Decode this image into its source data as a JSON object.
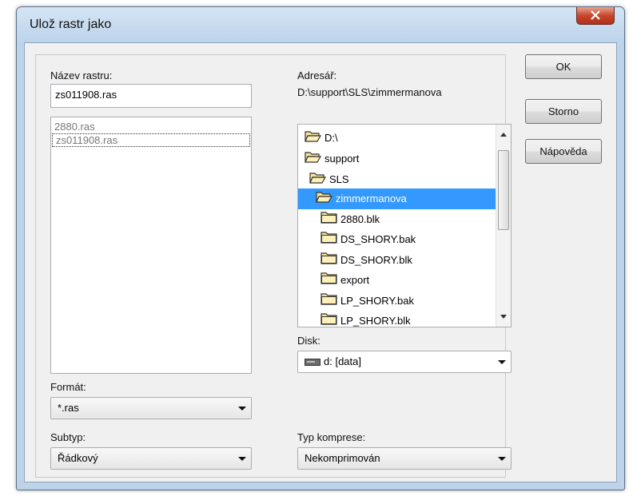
{
  "window": {
    "title": "Ulož rastr jako"
  },
  "name_section": {
    "label": "Název rastru:",
    "value": "zs011908.ras",
    "files": [
      "2880.ras",
      "zs011908.ras"
    ]
  },
  "dir_section": {
    "label": "Adresář:",
    "path": "D:\\support\\SLS\\zimmermanova",
    "tree": [
      {
        "label": "D:\\",
        "state": "open"
      },
      {
        "label": "support",
        "state": "open"
      },
      {
        "label": "SLS",
        "state": "open"
      },
      {
        "label": "zimmermanova",
        "state": "open",
        "selected": true
      },
      {
        "label": "2880.blk",
        "state": "closed"
      },
      {
        "label": "DS_SHORY.bak",
        "state": "closed"
      },
      {
        "label": "DS_SHORY.blk",
        "state": "closed"
      },
      {
        "label": "export",
        "state": "closed"
      },
      {
        "label": "LP_SHORY.bak",
        "state": "closed"
      },
      {
        "label": "LP_SHORY.blk",
        "state": "closed"
      }
    ]
  },
  "disk": {
    "label": "Disk:",
    "value": "d: [data]",
    "icon": "drive-icon"
  },
  "format": {
    "label": "Formát:",
    "value": "*.ras"
  },
  "subtype": {
    "label": "Subtyp:",
    "value": "Řádkový"
  },
  "compression": {
    "label": "Typ komprese:",
    "value": "Nekomprimován"
  },
  "buttons": {
    "ok": "OK",
    "cancel": "Storno",
    "help": "Nápověda"
  },
  "colors": {
    "selection": "#3399ff",
    "frame": "#bcd3ea",
    "close": "#c9452c"
  }
}
